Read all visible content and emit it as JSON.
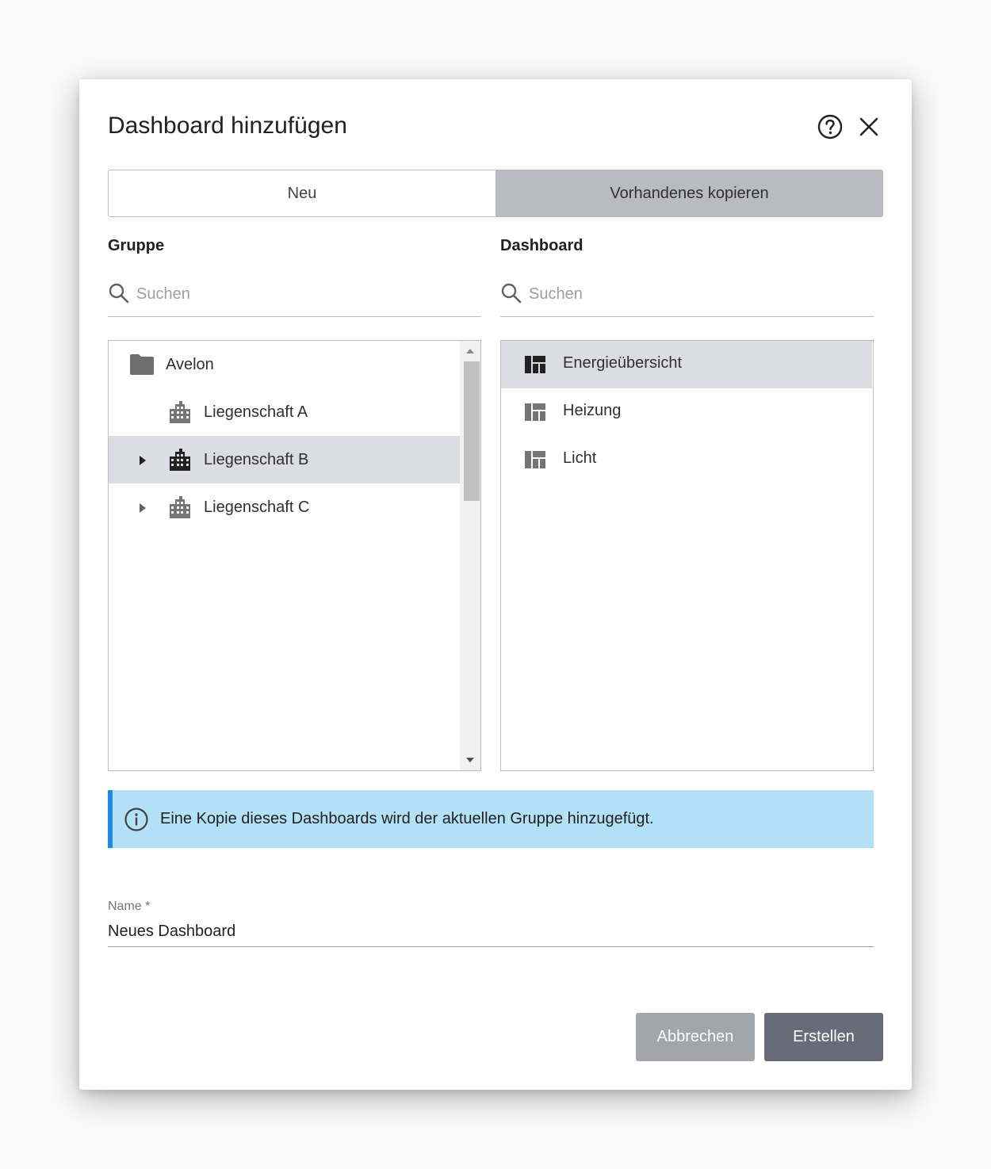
{
  "dialog": {
    "title": "Dashboard hinzufügen",
    "help_icon": "help-circle-icon",
    "close_icon": "close-icon"
  },
  "tabs": [
    {
      "label": "Neu",
      "selected": false
    },
    {
      "label": "Vorhandenes kopieren",
      "selected": true
    }
  ],
  "group": {
    "label": "Gruppe",
    "search_placeholder": "Suchen",
    "tree": [
      {
        "label": "Avelon",
        "icon": "folder-icon",
        "level": 0,
        "expandable": false,
        "selected": false
      },
      {
        "label": "Liegenschaft A",
        "icon": "building-icon",
        "level": 1,
        "expandable": false,
        "selected": false
      },
      {
        "label": "Liegenschaft B",
        "icon": "building-icon",
        "level": 1,
        "expandable": true,
        "selected": true
      },
      {
        "label": "Liegenschaft C",
        "icon": "building-icon",
        "level": 1,
        "expandable": true,
        "selected": false
      }
    ]
  },
  "dashboard": {
    "label": "Dashboard",
    "search_placeholder": "Suchen",
    "items": [
      {
        "label": "Energieübersicht",
        "icon": "dashboard-icon",
        "selected": true
      },
      {
        "label": "Heizung",
        "icon": "dashboard-icon",
        "selected": false
      },
      {
        "label": "Licht",
        "icon": "dashboard-icon",
        "selected": false
      }
    ]
  },
  "info": {
    "text": "Eine Kopie dieses Dashboards wird der aktuellen Gruppe hinzugefügt.",
    "icon": "info-icon"
  },
  "name_field": {
    "label": "Name *",
    "value": "Neues Dashboard"
  },
  "buttons": {
    "cancel_label": "Abbrechen",
    "create_label": "Erstellen"
  },
  "colors": {
    "tab_selected": "#b9bbc0",
    "row_selected": "#dcdde2",
    "info_bg": "#b3e1f7",
    "info_border": "#1e88e5",
    "cancel_bg": "#a2a5ac",
    "create_bg": "#676c78"
  }
}
